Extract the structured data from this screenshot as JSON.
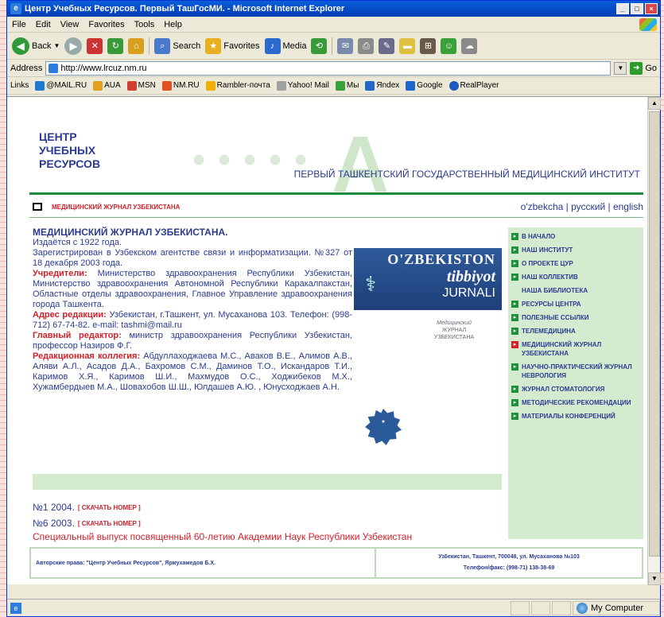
{
  "window": {
    "title": "Центр Учебных Ресурсов. Первый ТашГосМИ. - Microsoft Internet Explorer",
    "min_label": "_",
    "max_label": "□",
    "close_label": "×"
  },
  "menu": [
    "File",
    "Edit",
    "View",
    "Favorites",
    "Tools",
    "Help"
  ],
  "toolbar": {
    "back": "Back",
    "search": "Search",
    "favorites": "Favorites",
    "media": "Media"
  },
  "address": {
    "label": "Address",
    "value": "http://www.lrcuz.nm.ru",
    "go": "Go"
  },
  "links": {
    "label": "Links",
    "items": [
      "@MAIL.RU",
      "AUA",
      "MSN",
      "NM.RU",
      "Rambler-почта",
      "Yahoo! Mail",
      "Мы",
      "Яndex",
      "Google",
      "RealPlayer"
    ],
    "colors": [
      "#1f7acc",
      "#e0a020",
      "#d04030",
      "#e05020",
      "#f0b000",
      "#a0a0a0",
      "#3aa03a",
      "#2266cc",
      "#2266cc",
      "#1e5bbf"
    ]
  },
  "header": {
    "logo_lines": [
      "ЦЕНТР",
      "УЧЕБНЫХ",
      "РЕСУРСОВ"
    ],
    "institute": "ПЕРВЫЙ ТАШКЕНТСКИЙ ГОСУДАРСТВЕННЫЙ МЕДИЦИНСКИЙ ИНСТИТУТ"
  },
  "subbar": {
    "crumb": "МЕДИЦИНСКИЙ ЖУРНАЛ УЗБЕКИСТАНА",
    "languages": "o'zbekcha | русский | english"
  },
  "article": {
    "title": "МЕДИЦИНСКИЙ ЖУРНАЛ УЗБЕКИСТАНА.",
    "p1": "Издаётся с 1922 года.",
    "p2": "Зарегистрирован в Узбекском агентстве связи и информатизации. №327 от 18 декабря 2003 года.",
    "founders_label": "Учредители:",
    "founders": "Министерство здравоохранения Республики Узбекистан, Министерство здравоохранения Автономной Республики Каракалпакстан, Областные отделы здравоохранения, Главное Управление здравоохранения города Ташкента.",
    "address_label": "Адрес редакции:",
    "address_text": "Узбекистан, г.Ташкент, ул. Мусаханова 103. Телефон: (998-712) 67-74-82. e-mail: tashmi@mail.ru",
    "editor_label": "Главный редактор:",
    "editor_text": "министр здравоохранения Республики Узбекистан, профессор Назиров Ф.Г.",
    "board_label": "Редакционная коллегия:",
    "board_text": "Абдуллаходжаева М.С., Аваков В.Е., Алимов А.В., Аляви А.Л., Асадов Д.А., Бахромов С.М., Даминов Т.О., Искандаров Т.И., Каримов Х.Я., Каримов Ш.И., Махмудов О.С., Ходжибеков М.Х., Хужамбердыев М.А., Шовахобов Ш.Ш., Юлдашев А.Ю. , Юнусходжаев А.Н."
  },
  "journal_logo": {
    "line1": "O'ZBEKISTON",
    "line2": "tibbiyot",
    "line3": "JURNALI"
  },
  "small_logo": {
    "line1": "Медицинский",
    "line2": "ЖУРНАЛ",
    "line3": "УЗБЕКИСТАНА"
  },
  "issues": [
    {
      "label": "№1 2004.",
      "link": "[ СКАЧАТЬ НОМЕР ]"
    },
    {
      "label": "№6 2003.",
      "link": "[ СКАЧАТЬ НОМЕР ]"
    }
  ],
  "special_issue": "Специальный выпуск посвященный 60-летию Академии Наук Республики Узбекистан",
  "sidebar": [
    {
      "label": "В НАЧАЛО",
      "active": false
    },
    {
      "label": "НАШ ИНСТИТУТ",
      "active": false
    },
    {
      "label": "О ПРОЕКТЕ ЦУР",
      "active": false
    },
    {
      "label": "НАШ КОЛЛЕКТИВ",
      "active": false
    },
    {
      "label": "НАША БИБЛИОТЕКА",
      "active": false
    },
    {
      "label": "РЕСУРСЫ ЦЕНТРА",
      "active": false
    },
    {
      "label": "ПОЛЕЗНЫЕ ССЫЛКИ",
      "active": false
    },
    {
      "label": "ТЕЛЕМЕДИЦИНА",
      "active": false
    },
    {
      "label": "МЕДИЦИНСКИЙ ЖУРНАЛ УЗБЕКИСТАНА",
      "active": true
    },
    {
      "label": "НАУЧНО-ПРАКТИЧЕСКИЙ ЖУРНАЛ НЕВРОЛОГИЯ",
      "active": false
    },
    {
      "label": "ЖУРНАЛ СТОМАТОЛОГИЯ",
      "active": false
    },
    {
      "label": "МЕТОДИЧЕСКИЕ РЕКОМЕНДАЦИИ",
      "active": false
    },
    {
      "label": "МАТЕРИАЛЫ КОНФЕРЕНЦИЙ",
      "active": false
    }
  ],
  "footer": {
    "copyright": "Авторские права: \"Центр Учебных Ресурсов\", Ярмухамедов Б.Х.",
    "address": "Узбекистан, Ташкент, 700048, ул. Мусаханова №103",
    "phone": "Телефон/факс: (998-71) 138-38-69"
  },
  "status": {
    "zone": "My Computer"
  },
  "colors": {
    "accent_green": "#1e8f3c",
    "accent_red": "#d0202a",
    "text_blue": "#2a3b8f",
    "panel_green": "#d4ebd0"
  }
}
